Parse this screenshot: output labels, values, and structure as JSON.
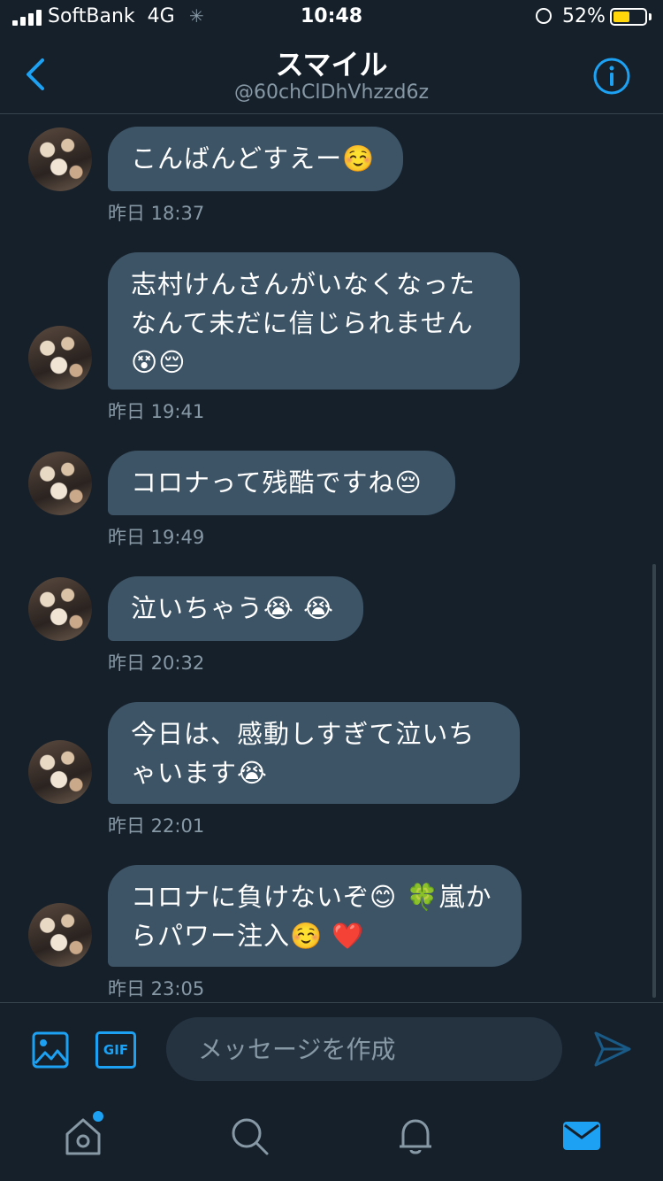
{
  "status_bar": {
    "carrier": "SoftBank",
    "network": "4G",
    "time": "10:48",
    "battery_percent": "52%",
    "battery_level": 0.52
  },
  "header": {
    "title": "スマイル",
    "handle": "@60chClDhVhzzd6z"
  },
  "messages": [
    {
      "text": "こんばんどすえー☺️",
      "time": "昨日 18:37"
    },
    {
      "text": "志村けんさんがいなくなったなんて未だに信じられません😵😔",
      "time": "昨日 19:41"
    },
    {
      "text": "コロナって残酷ですね😔",
      "time": "昨日 19:49"
    },
    {
      "text": "泣いちゃう😭 😭",
      "time": "昨日 20:32"
    },
    {
      "text": "今日は、感動しすぎて泣いちゃいます😭",
      "time": "昨日 22:01"
    },
    {
      "text": "コロナに負けないぞ😊 🍀嵐からパワー注入☺️ ❤️",
      "time": "昨日 23:05"
    }
  ],
  "compose": {
    "placeholder": "メッセージを作成",
    "gif_label": "GIF"
  },
  "icons": {
    "back": "chevron-left-icon",
    "info": "info-icon",
    "image": "image-icon",
    "send": "send-icon",
    "home": "home-icon",
    "search": "search-icon",
    "notifications": "bell-icon",
    "messages": "mail-icon"
  },
  "colors": {
    "background": "#15202b",
    "bubble": "#3d5466",
    "accent": "#1da1f2",
    "secondary_text": "#8899a6"
  }
}
